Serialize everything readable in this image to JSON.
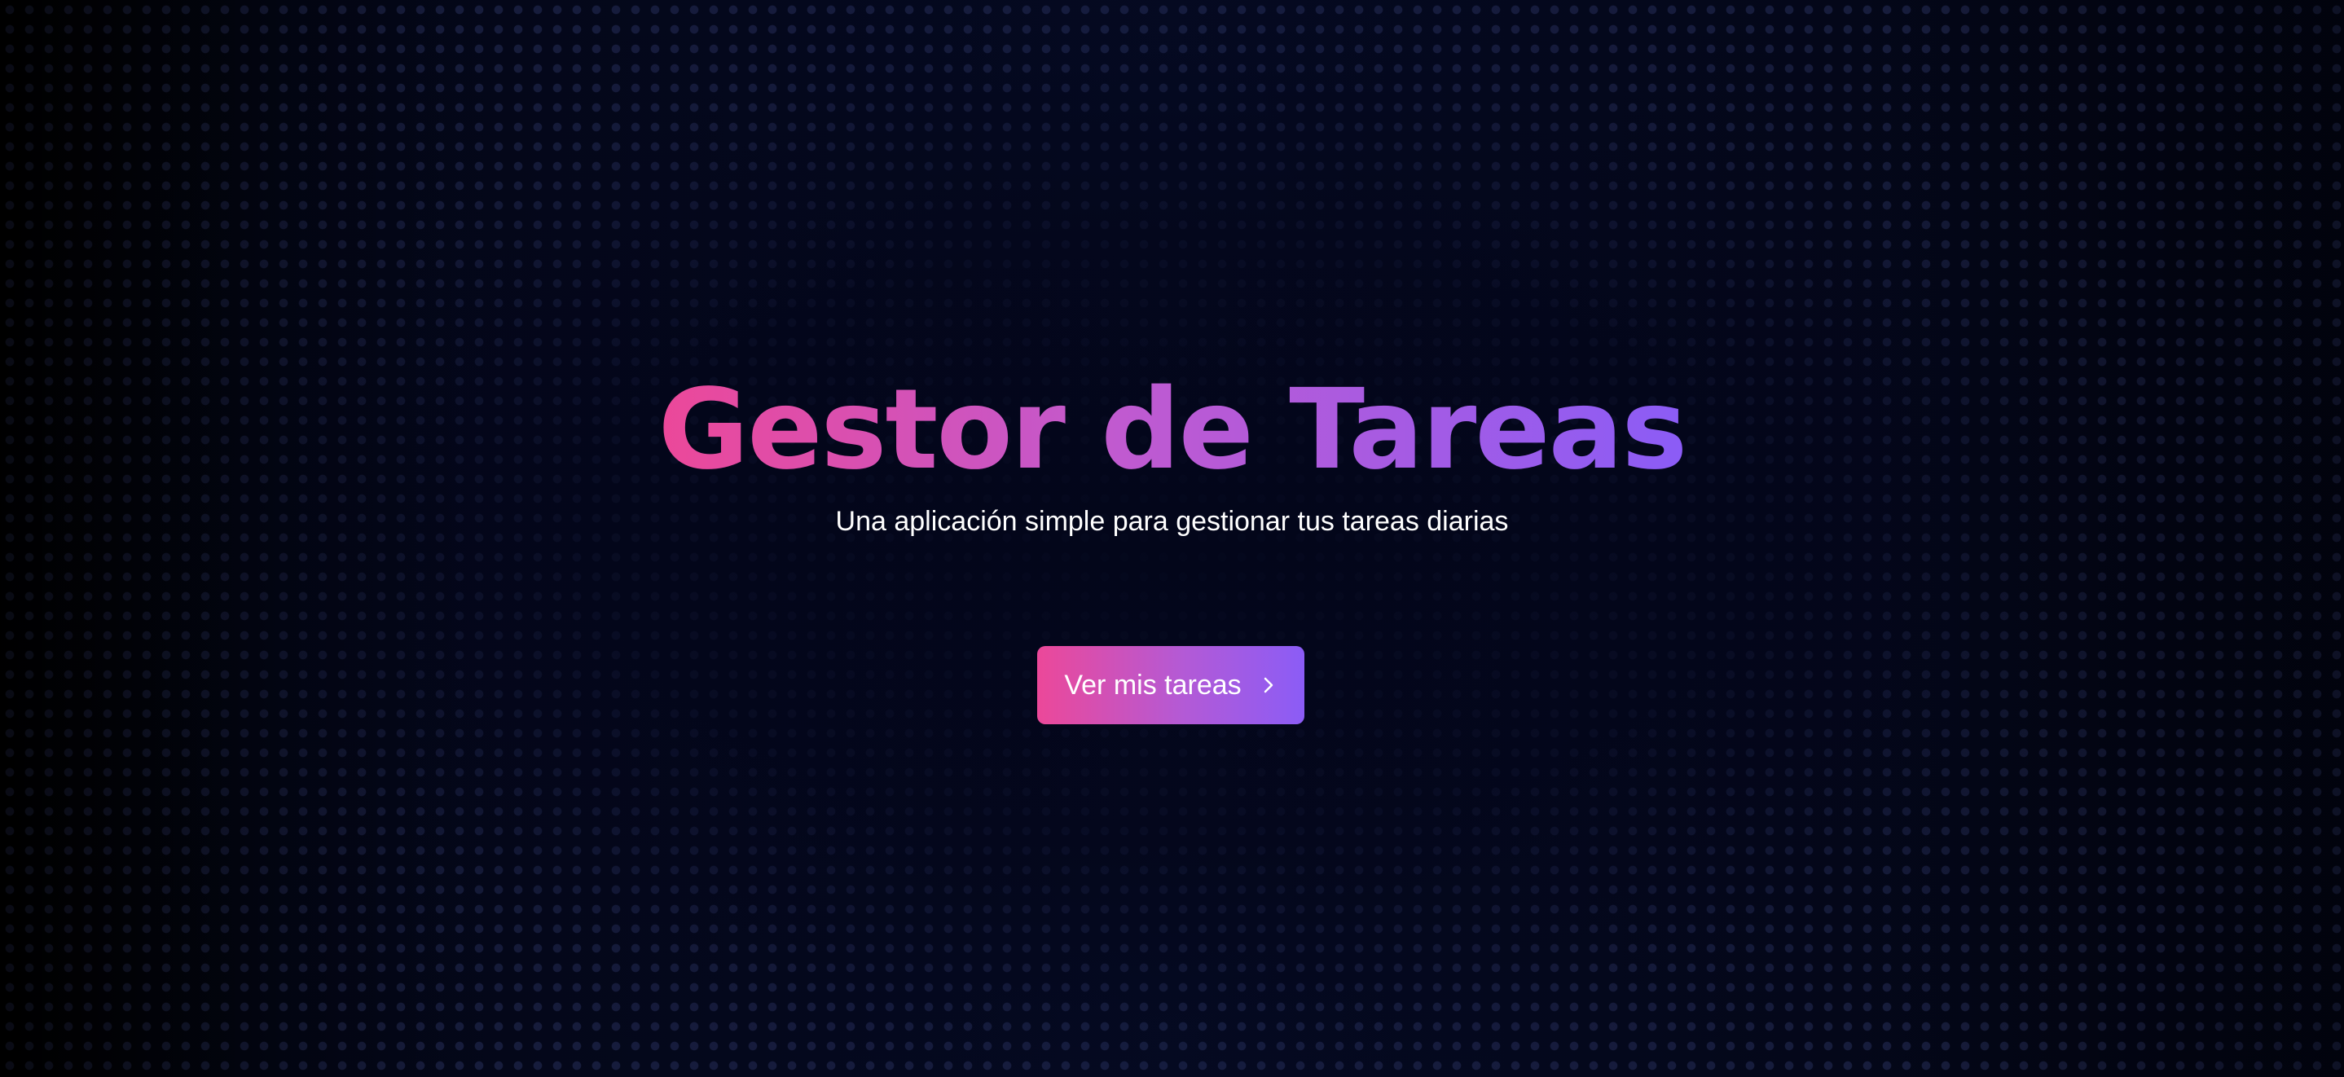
{
  "hero": {
    "title": "Gestor de Tareas",
    "subtitle": "Una aplicación simple para gestionar tus tareas diarias",
    "cta_label": "Ver mis tareas",
    "cta_icon": "chevron-right-icon"
  },
  "colors": {
    "background": "#03061a",
    "gradient_start": "#ec4899",
    "gradient_end": "#8b5cf6",
    "text": "#ffffff"
  }
}
